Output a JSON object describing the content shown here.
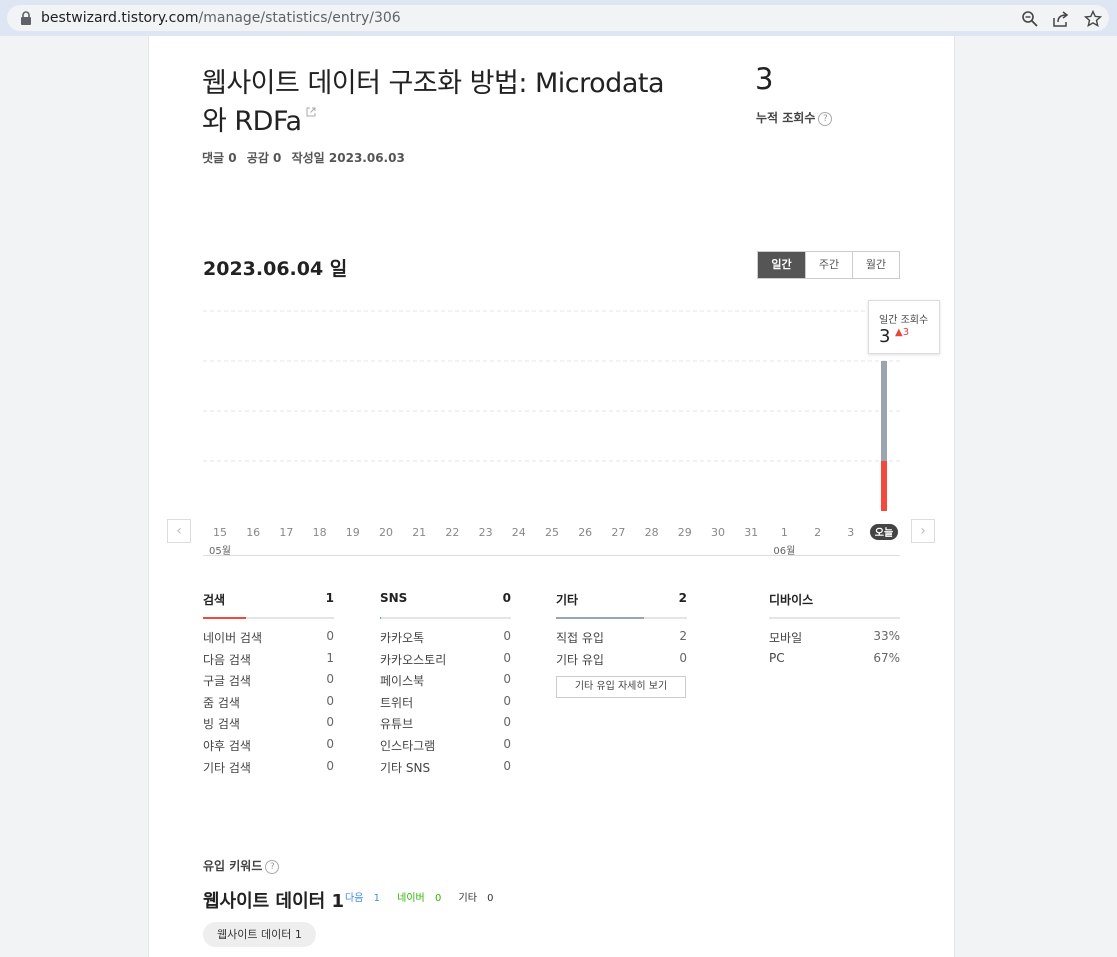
{
  "browser": {
    "url_host": "bestwizard.tistory.com",
    "url_path": "/manage/statistics/entry/306"
  },
  "post": {
    "title_line1": "웹사이트 데이터 구조화 방법: Microdata",
    "title_line2": "와 RDFa",
    "comments": "댓글 0",
    "likes": "공감 0",
    "created": "작성일 2023.06.03"
  },
  "total": {
    "value": "3",
    "label": "누적 조회수"
  },
  "chart_header": {
    "date": "2023.06.04 일",
    "tabs": [
      "일간",
      "주간",
      "월간"
    ]
  },
  "tooltip": {
    "label": "일간 조회수",
    "value": "3",
    "delta": "3"
  },
  "chart_data": {
    "type": "bar",
    "categories": [
      "15",
      "16",
      "17",
      "18",
      "19",
      "20",
      "21",
      "22",
      "23",
      "24",
      "25",
      "26",
      "27",
      "28",
      "29",
      "30",
      "31",
      "1",
      "2",
      "3",
      "오늘"
    ],
    "month_labels": [
      {
        "label": "05월",
        "index": 0
      },
      {
        "label": "06월",
        "index": 17
      }
    ],
    "series": [
      {
        "values": [
          0,
          0,
          0,
          0,
          0,
          0,
          0,
          0,
          0,
          0,
          0,
          0,
          0,
          0,
          0,
          0,
          0,
          0,
          0,
          0,
          1
        ]
      },
      {
        "values": [
          0,
          0,
          0,
          0,
          0,
          0,
          0,
          0,
          0,
          0,
          0,
          0,
          0,
          0,
          0,
          0,
          0,
          0,
          0,
          0,
          2
        ]
      }
    ],
    "colors": [
      "#f4473e",
      "#9aa5b1"
    ],
    "ylim": [
      0,
      4
    ],
    "grid": true
  },
  "stats": {
    "search": {
      "title": "검색",
      "count": "1",
      "color": "#f4473e",
      "fill": 0.33,
      "rows": [
        {
          "label": "네이버 검색",
          "value": "0"
        },
        {
          "label": "다음 검색",
          "value": "1"
        },
        {
          "label": "구글 검색",
          "value": "0"
        },
        {
          "label": "줌 검색",
          "value": "0"
        },
        {
          "label": "빙 검색",
          "value": "0"
        },
        {
          "label": "야후 검색",
          "value": "0"
        },
        {
          "label": "기타 검색",
          "value": "0"
        }
      ]
    },
    "sns": {
      "title": "SNS",
      "count": "0",
      "color": "#26c9a7",
      "fill": 0.01,
      "rows": [
        {
          "label": "카카오톡",
          "value": "0"
        },
        {
          "label": "카카오스토리",
          "value": "0"
        },
        {
          "label": "페이스북",
          "value": "0"
        },
        {
          "label": "트위터",
          "value": "0"
        },
        {
          "label": "유튜브",
          "value": "0"
        },
        {
          "label": "인스타그램",
          "value": "0"
        },
        {
          "label": "기타 SNS",
          "value": "0"
        }
      ]
    },
    "other": {
      "title": "기타",
      "count": "2",
      "color": "#9aa5b1",
      "fill": 0.67,
      "rows": [
        {
          "label": "직접 유입",
          "value": "2"
        },
        {
          "label": "기타 유입",
          "value": "0"
        }
      ],
      "detail_button": "기타 유입 자세히 보기"
    },
    "device": {
      "title": "디바이스",
      "rows": [
        {
          "label": "모바일",
          "value": "33%"
        },
        {
          "label": "PC",
          "value": "67%"
        }
      ]
    }
  },
  "keywords": {
    "label": "유입 키워드",
    "title": "웹사이트 데이터 1",
    "daum": "다음",
    "daum_count": "1",
    "naver": "네이버",
    "naver_count": "0",
    "etc": "기타",
    "etc_count": "0",
    "chip": "웹사이트 데이터 1",
    "colors": {
      "daum": "#3d8ee5",
      "naver": "#2db400",
      "etc": "#333333"
    }
  }
}
